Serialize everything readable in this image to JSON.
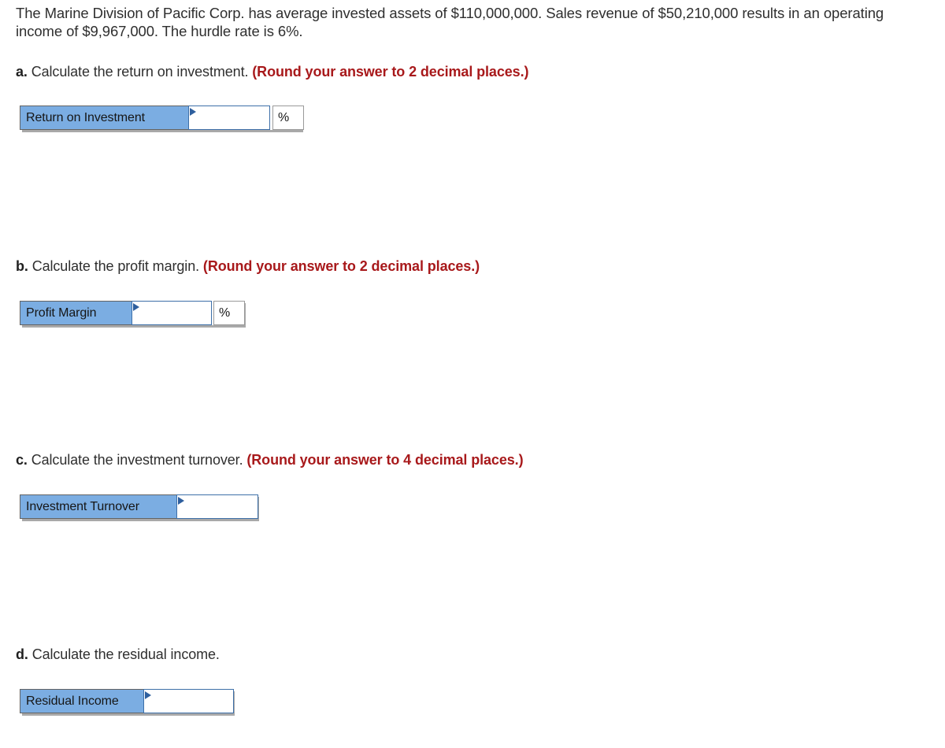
{
  "problem": {
    "intro": "The Marine Division of Pacific Corp. has average invested assets of $110,000,000. Sales revenue of $50,210,000 results in an operating income of $9,967,000. The hurdle rate is 6%.",
    "average_invested_assets": "$110,000,000",
    "sales_revenue": "$50,210,000",
    "operating_income": "$9,967,000",
    "hurdle_rate": "6%"
  },
  "colors": {
    "label_blue": "#7BADE2",
    "instruction_red": "#A8191B",
    "input_border_blue": "#3D6FA8",
    "text_gray": "#2f2f2f"
  },
  "parts": [
    {
      "letter": "a.",
      "text": "Calculate the return on investment.",
      "rounding": "(Round your answer to 2 decimal places.)",
      "widget": {
        "label": "Return on Investment",
        "value": "",
        "placeholder": "",
        "unit": "%",
        "has_unit": true
      }
    },
    {
      "letter": "b.",
      "text": "Calculate the profit margin.",
      "rounding": "(Round your answer to 2 decimal places.)",
      "widget": {
        "label": "Profit Margin",
        "value": "",
        "placeholder": "",
        "unit": "%",
        "has_unit": true
      }
    },
    {
      "letter": "c.",
      "text": "Calculate the investment turnover.",
      "rounding": "(Round your answer to 4 decimal places.)",
      "widget": {
        "label": "Investment Turnover",
        "value": "",
        "placeholder": "",
        "unit": "",
        "has_unit": false
      }
    },
    {
      "letter": "d.",
      "text": "Calculate the residual income.",
      "rounding": "",
      "widget": {
        "label": "Residual Income",
        "value": "",
        "placeholder": "",
        "unit": "",
        "has_unit": false
      }
    }
  ]
}
